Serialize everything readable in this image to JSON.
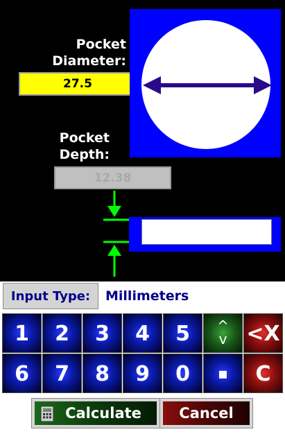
{
  "pocket_diameter": {
    "label_line1": "Pocket",
    "label_line2": "Diameter:",
    "value": "27.5"
  },
  "pocket_depth": {
    "label_line1": "Pocket",
    "label_line2": "Depth:",
    "value": "12.38"
  },
  "input_type": {
    "button_label": "Input Type:",
    "value": "Millimeters"
  },
  "keypad": {
    "row1": [
      "1",
      "2",
      "3",
      "4",
      "5",
      "^\nv",
      "<X"
    ],
    "row2": [
      "6",
      "7",
      "8",
      "9",
      "0",
      "▪",
      "C"
    ]
  },
  "actions": {
    "calculate_label": "Calculate",
    "cancel_label": "Cancel"
  },
  "colors": {
    "diagram_background": "#0000ff",
    "arrow": "#2a0a8a",
    "depth_arrow": "#00ff00",
    "field_active": "#ffff00"
  },
  "icons": {
    "toggle": "up-down-chevrons-icon",
    "calculate": "calculator-icon"
  }
}
